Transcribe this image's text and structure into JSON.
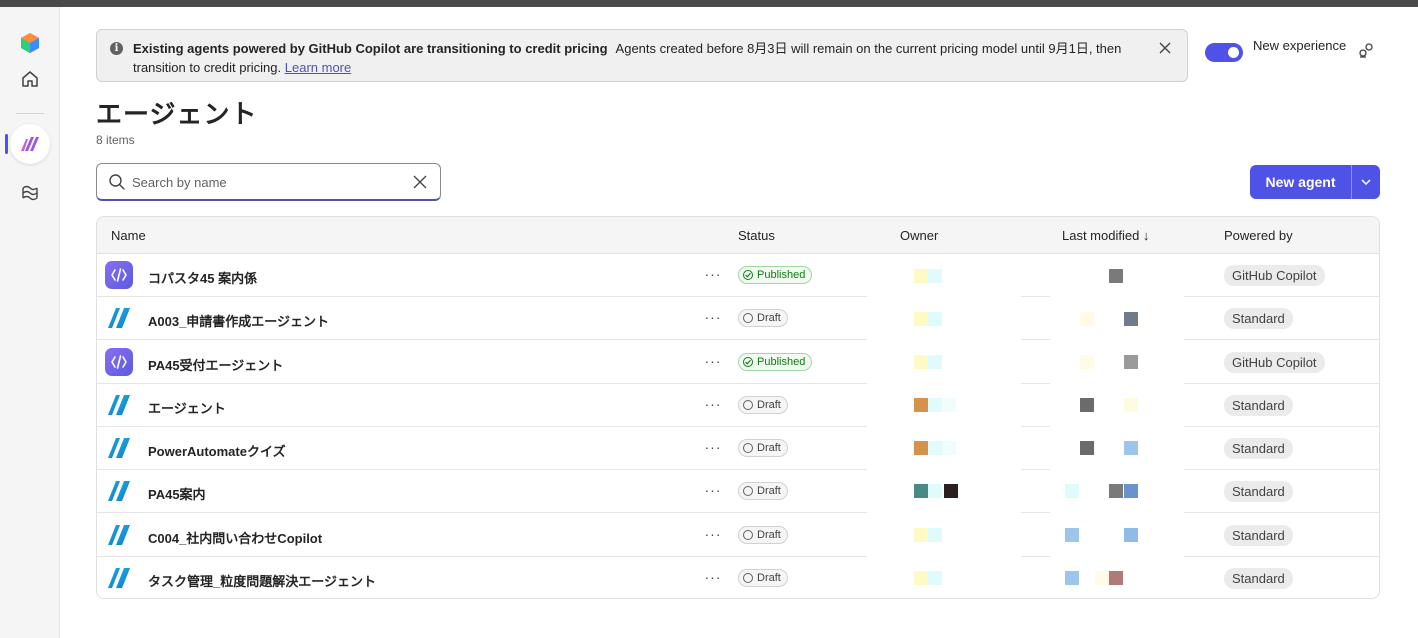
{
  "rail": {
    "items": [
      {
        "name": "app-logo"
      },
      {
        "name": "home"
      },
      {
        "name": "agents"
      },
      {
        "name": "agent-library"
      }
    ]
  },
  "banner": {
    "title": "Existing agents powered by GitHub Copilot are transitioning to credit pricing",
    "body": "Agents created before 8月3日 will remain on the current pricing model until 9月1日, then transition to credit pricing.",
    "link": "Learn more"
  },
  "header": {
    "toggle_label": "New experience",
    "toggle_on": true
  },
  "page": {
    "title": "エージェント",
    "count": "8 items"
  },
  "search": {
    "placeholder": "Search by name",
    "value": ""
  },
  "actions": {
    "new_agent": "New agent"
  },
  "table": {
    "columns": {
      "name": "Name",
      "status": "Status",
      "owner": "Owner",
      "modified": "Last modified ↓",
      "powered": "Powered by"
    },
    "rows": [
      {
        "name": "コパスタ45 案内係",
        "status": "Published",
        "status_kind": "published",
        "powered": "GitHub Copilot",
        "icon": "copilot"
      },
      {
        "name": "A003_申請書作成エージェント",
        "status": "Draft",
        "status_kind": "draft",
        "powered": "Standard",
        "icon": "standard"
      },
      {
        "name": "PA45受付エージェント",
        "status": "Published",
        "status_kind": "published",
        "powered": "GitHub Copilot",
        "icon": "copilot"
      },
      {
        "name": "エージェント",
        "status": "Draft",
        "status_kind": "draft",
        "powered": "Standard",
        "icon": "standard"
      },
      {
        "name": "PowerAutomateクイズ",
        "status": "Draft",
        "status_kind": "draft",
        "powered": "Standard",
        "icon": "standard"
      },
      {
        "name": "PA45案内",
        "status": "Draft",
        "status_kind": "draft",
        "powered": "Standard",
        "icon": "standard"
      },
      {
        "name": "C004_社内問い合わせCopilot",
        "status": "Draft",
        "status_kind": "draft",
        "powered": "Standard",
        "icon": "standard"
      },
      {
        "name": "タスク管理_粒度問題解決エージェント",
        "status": "Draft",
        "status_kind": "draft",
        "powered": "Standard",
        "icon": "standard"
      }
    ]
  },
  "colors": {
    "accent": "#4f52e6",
    "published": "#107c10",
    "draft": "#616161"
  }
}
